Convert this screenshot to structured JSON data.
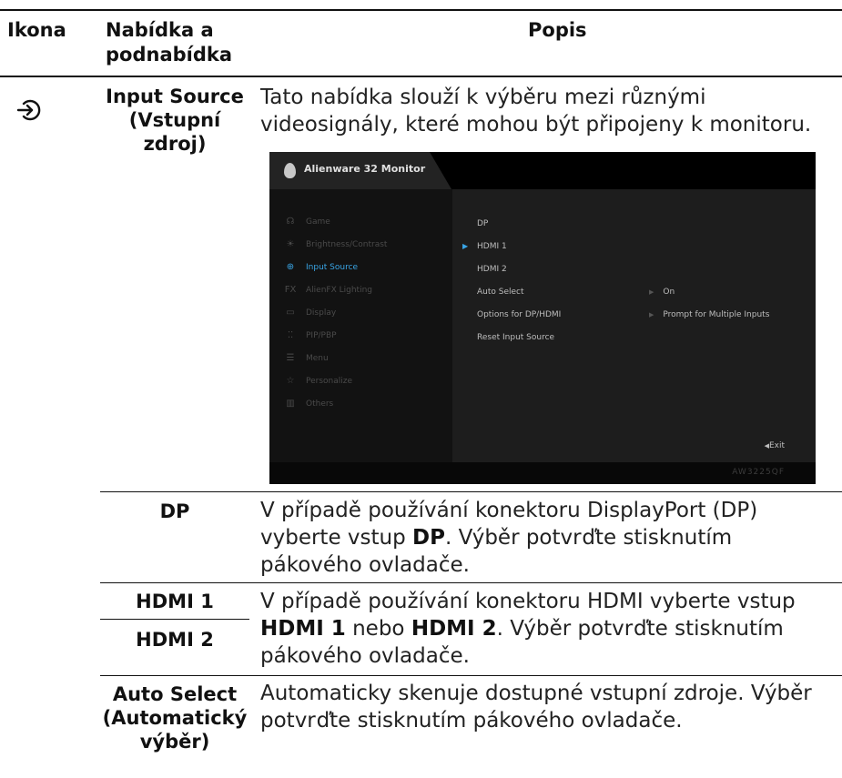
{
  "header": {
    "col_icon": "Ikona",
    "col_menu": "Nabídka a\npodnabídka",
    "col_desc": "Popis"
  },
  "input_source": {
    "icon": "input-source-icon",
    "label_line1": "Input Source",
    "label_line2": "(Vstupní zdroj)",
    "description": "Tato nabídka slouží k výběru mezi různými videosignály, které mohou být připojeny k monitoru."
  },
  "osd": {
    "brand": "Alienware 32 Monitor",
    "menu": [
      {
        "icon": "☊",
        "label": "Game"
      },
      {
        "icon": "☀",
        "label": "Brightness/Contrast"
      },
      {
        "icon": "⊕",
        "label": "Input Source"
      },
      {
        "icon": "FX",
        "label": "AlienFX Lighting"
      },
      {
        "icon": "▭",
        "label": "Display"
      },
      {
        "icon": "⁚⁚",
        "label": "PIP/PBP"
      },
      {
        "icon": "☰",
        "label": "Menu"
      },
      {
        "icon": "☆",
        "label": "Personalize"
      },
      {
        "icon": "▥",
        "label": "Others"
      }
    ],
    "selected_menu_index": 2,
    "options": [
      "DP",
      "HDMI 1",
      "HDMI 2",
      "Auto Select",
      "Options for DP/HDMI",
      "Reset Input Source"
    ],
    "selected_option_index": 1,
    "values": {
      "auto_select": "On",
      "options_dp_hdmi": "Prompt for Multiple Inputs"
    },
    "exit": "Exit",
    "model": "AW3225QF"
  },
  "rows": {
    "dp": {
      "label": "DP",
      "desc_pre": "V případě používání konektoru DisplayPort (DP) vyberte vstup ",
      "desc_bold": "DP",
      "desc_post": ". Výběr potvrďte stisknutím pákového ovladače."
    },
    "hdmi": {
      "label1": "HDMI 1",
      "label2": "HDMI 2",
      "desc_pre": "V případě používání konektoru HDMI vyberte vstup ",
      "desc_bold1": "HDMI 1",
      "desc_mid": " nebo ",
      "desc_bold2": "HDMI 2",
      "desc_post": ". Výběr potvrďte stisknutím pákového ovladače."
    },
    "auto_select": {
      "label_line1": "Auto Select",
      "label_line2": "(Automatický",
      "label_line3": "výběr)",
      "description": "Automaticky skenuje dostupné vstupní zdroje. Výběr potvrďte stisknutím pákového ovladače."
    }
  }
}
